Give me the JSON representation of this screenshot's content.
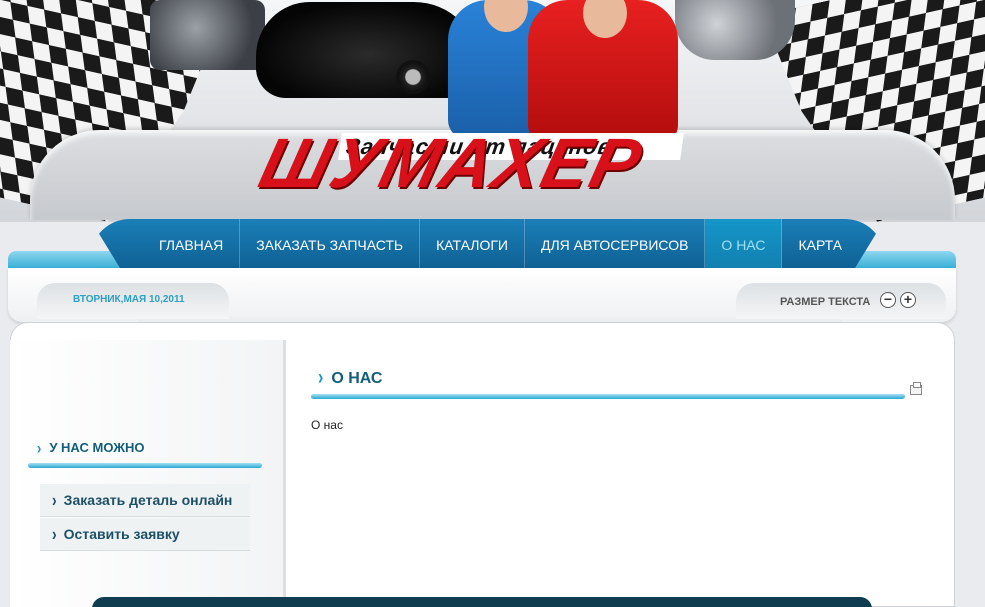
{
  "header": {
    "logo_subtitle": "Запчасти от пацанов",
    "logo_title": "ШУМАХЕР"
  },
  "nav": {
    "items": [
      {
        "label": "ГЛАВНАЯ"
      },
      {
        "label": "ЗАКАЗАТЬ ЗАПЧАСТЬ"
      },
      {
        "label": "КАТАЛОГИ"
      },
      {
        "label": "ДЛЯ АВТОСЕРВИСОВ"
      },
      {
        "label": "О НАС"
      },
      {
        "label": "КАРТА"
      }
    ],
    "active_index": 4
  },
  "infobar": {
    "date": "ВТОРНИК,МАЯ 10,2011",
    "text_size_label": "РАЗМЕР ТЕКСТА",
    "decrease_glyph": "−",
    "increase_glyph": "+"
  },
  "sidebar": {
    "heading": "У НАС МОЖНО",
    "items": [
      {
        "label": "Заказать деталь онлайн"
      },
      {
        "label": "Оставить заявку"
      }
    ]
  },
  "main": {
    "heading": "О НАС",
    "body": "О нас"
  },
  "colors": {
    "nav_blue": "#0e5f92",
    "accent_cyan": "#2ba7d2",
    "logo_red": "#d8101a",
    "heading_teal": "#145d7a"
  }
}
